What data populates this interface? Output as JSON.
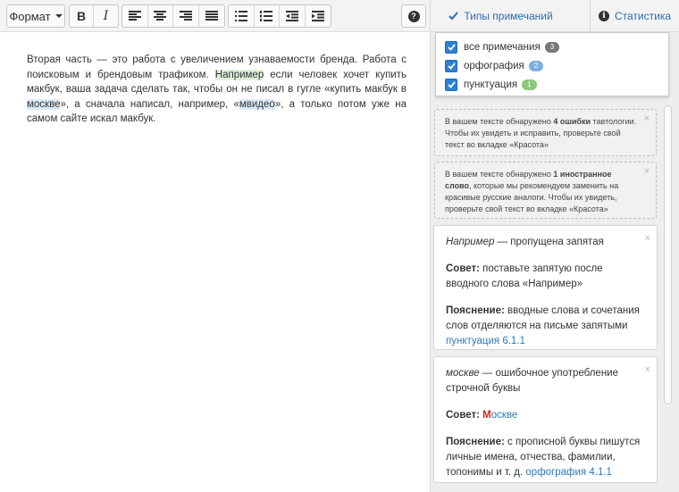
{
  "toolbar": {
    "format_label": "Формат",
    "bold_label": "B",
    "italic_label": "I",
    "help_label": "?",
    "tab_types_label": "Типы примечаний",
    "tab_stats_label": "Статистика",
    "accent_color": "#2a6db0",
    "icons": [
      "format-dropdown",
      "bold-icon",
      "italic-icon",
      "align-left-icon",
      "align-center-icon",
      "align-right-icon",
      "align-justify-icon",
      "bullet-list-icon",
      "numbered-list-icon",
      "outdent-icon",
      "indent-icon",
      "help-icon",
      "check-icon",
      "info-icon"
    ]
  },
  "editor": {
    "p1": "Вторая часть — это работа с увеличением узнаваемости бренда. Работа с поисковым и брендовым трафиком. ",
    "hl1": "Например",
    "p2": " если человек хочет купить макбук, ваша задача сделать так, чтобы он не писал в гугле «купить макбук в ",
    "hl2": "москве",
    "p3": "», а сначала написал, например, «",
    "hl3": "мвидео",
    "p4": "», а только потом уже на самом сайте искал макбук.",
    "highlight_colors": {
      "punctuation": "#dff0d8",
      "spelling": "#dbe9f8"
    }
  },
  "filters": [
    {
      "label": "все примечания",
      "count": "3",
      "color": "#777777",
      "checked": true
    },
    {
      "label": "орфография",
      "count": "2",
      "color": "#7fb0e0",
      "checked": true
    },
    {
      "label": "пунктуация",
      "count": "1",
      "color": "#8cc77a",
      "checked": true
    }
  ],
  "notes": [
    {
      "pre": "В вашем тексте обнаружено ",
      "strong": "4 ошибки",
      "post": " тавтологии. Чтобы их увидеть и исправить, проверьте свой текст во вкладке «Красота»"
    },
    {
      "pre": "В вашем тексте обнаружено ",
      "strong": "1 иностранное слово",
      "post": ", которые мы рекомендуем заменить на красивые русские аналоги. Чтобы их увидеть, проверьте свой текст во вкладке «Красота»"
    }
  ],
  "cards": [
    {
      "word": "Например",
      "title_rest": " — пропущена запятая",
      "advice_label": "Совет:",
      "advice_text": " поставьте запятую после вводного слова «Например»",
      "expl_label": "Пояснение:",
      "expl_text": " вводные слова и сочетания слов отделяются на письме запятыми ",
      "link": "пунктуация 6.1.1"
    },
    {
      "word": "москве",
      "title_rest": " — ошибочное употребление строчной буквы",
      "advice_label": "Совет:",
      "advice_first": "М",
      "advice_rest": "оскве",
      "expl_label": "Пояснение:",
      "expl_text": " с прописной буквы пишутся личные имена, отчества, фамилии, топонимы и т. д. ",
      "link": "орфография 4.1.1"
    }
  ],
  "close_glyph": "×"
}
